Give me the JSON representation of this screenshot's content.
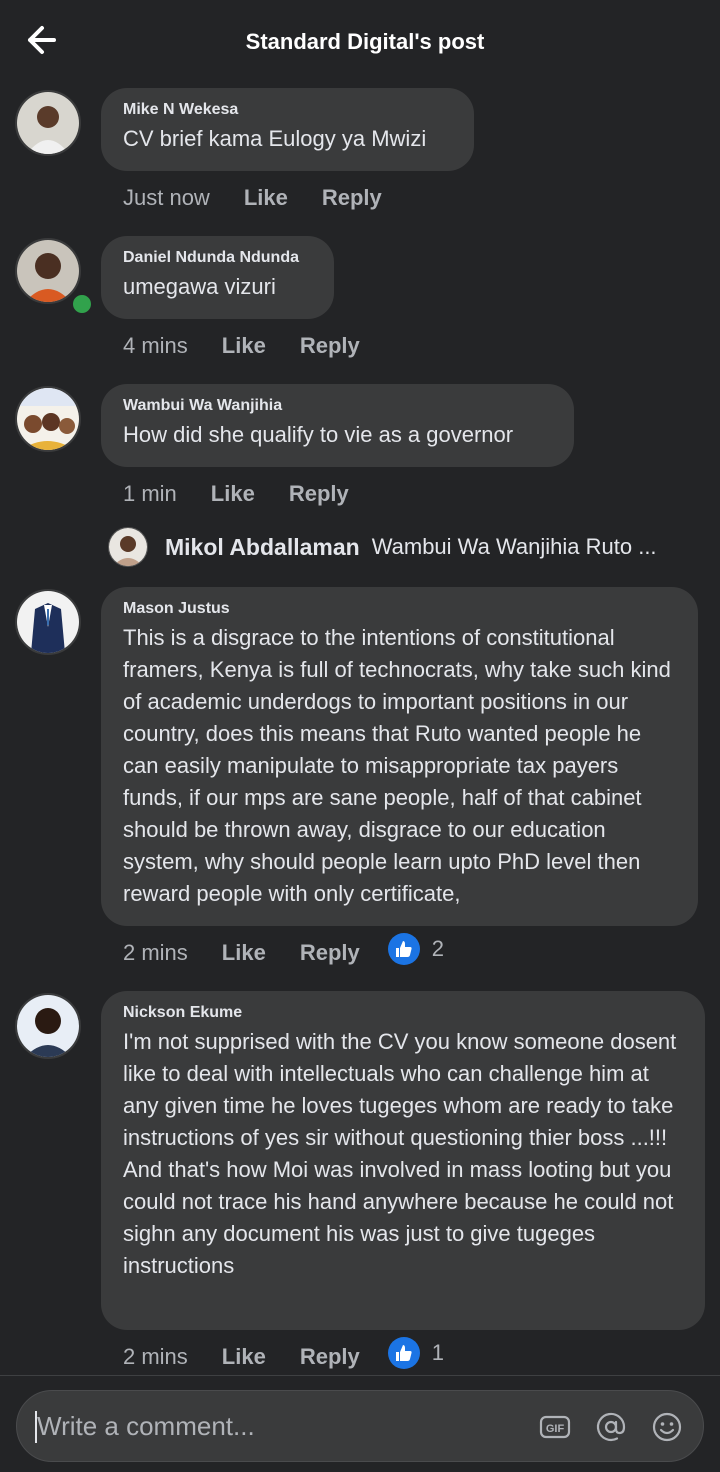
{
  "header": {
    "title": "Standard Digital's post"
  },
  "actions": {
    "like": "Like",
    "reply": "Reply"
  },
  "comments": [
    {
      "author": "Mike N Wekesa",
      "text": "CV brief kama Eulogy ya Mwizi",
      "time": "Just now"
    },
    {
      "author": "Daniel Ndunda Ndunda",
      "text": "umegawa vizuri",
      "time": "4 mins"
    },
    {
      "author": "Wambui Wa Wanjihia",
      "text": "How did she qualify to vie as a governor",
      "time": "1 min"
    },
    {
      "author": "Mason Justus",
      "text": "This is a disgrace to the intentions of constitutional framers, Kenya is full of technocrats, why take such kind of academic underdogs to important positions in our country, does this means that Ruto wanted people he can easily manipulate to misappropriate tax payers funds, if our mps are sane people, half of that cabinet should be thrown away, disgrace to our education system, why should people learn upto PhD level then reward people with only certificate,",
      "time": "2 mins",
      "reactions": "2"
    },
    {
      "author": "Nickson Ekume",
      "text": "I'm not supprised with the CV you know someone dosent like to deal with intellectuals who can challenge him at any given time he loves tugeges whom are ready to take instructions of yes sir without questioning thier boss ...!!! And that's how Moi was involved in mass looting but you could not trace his hand anywhere because he could not sighn any document his was just to give tugeges instructions",
      "time": "2 mins",
      "reactions": "1"
    }
  ],
  "reply_preview": {
    "author": "Mikol Abdallaman",
    "text": "Wambui Wa Wanjihia Ruto ..."
  },
  "composer": {
    "placeholder": "Write a comment..."
  },
  "icons": [
    "back-arrow-icon",
    "like-reaction-icon",
    "gif-icon",
    "at-mention-icon",
    "emoji-icon"
  ],
  "colors": {
    "background": "#232426",
    "bubble": "#3a3b3c",
    "like_blue": "#1b74e4",
    "online_green": "#31a24c"
  }
}
